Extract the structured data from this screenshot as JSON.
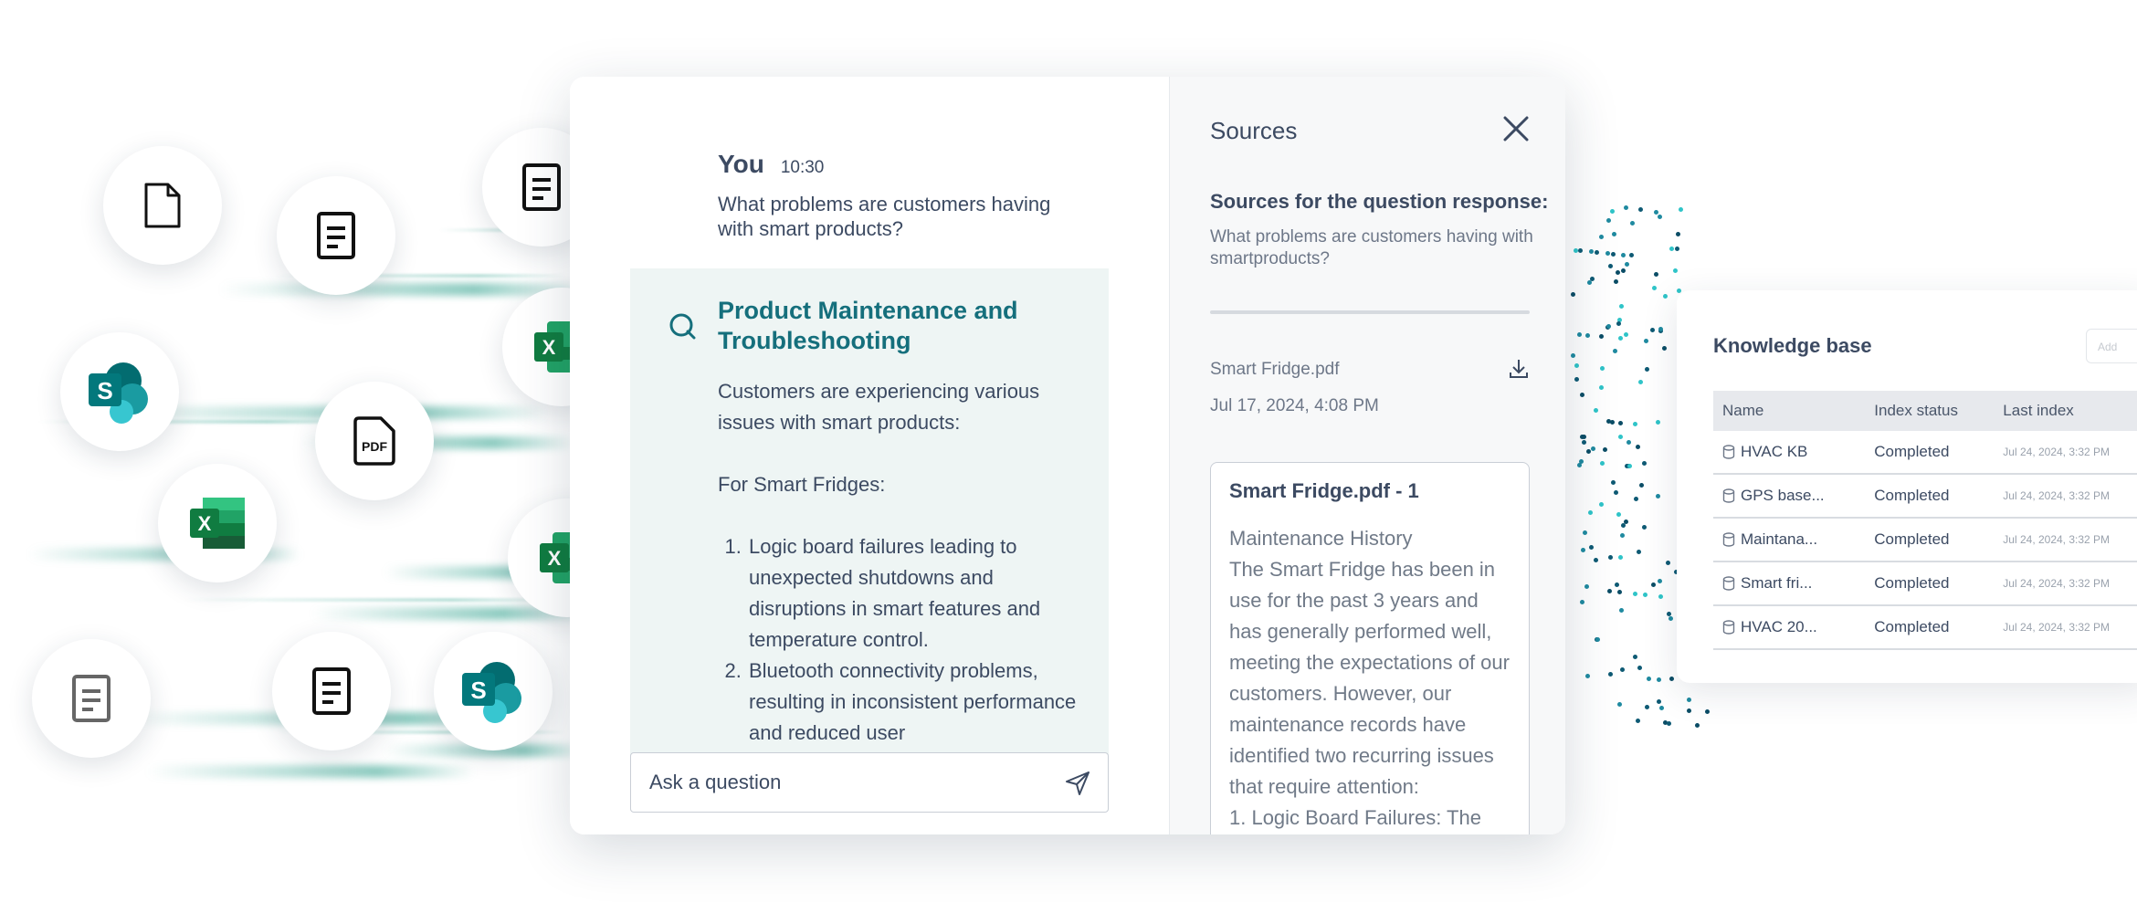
{
  "chat": {
    "user_name": "You",
    "time": "10:30",
    "question": "What problems are customers having with smart products?",
    "answer_title": "Product Maintenance and Troubleshooting",
    "answer_intro": "Customers are experiencing various issues with smart products:",
    "answer_section": "For Smart Fridges:",
    "answer_items": [
      "Logic board failures leading to unexpected shutdowns and disruptions in smart features and temperature control.",
      "Bluetooth connectivity problems, resulting in inconsistent performance and reduced user"
    ],
    "input_placeholder": "Ask a question"
  },
  "sources": {
    "title": "Sources",
    "subtitle": "Sources for the question response:",
    "question": "What problems are customers having with smartproducts?",
    "file_name": "Smart Fridge.pdf",
    "file_date": "Jul 17, 2024, 4:08 PM",
    "chunk_title": "Smart Fridge.pdf - 1",
    "chunk_text": "Maintenance History\nThe Smart Fridge has been in use for the past 3 years and has generally performed well, meeting the expectations of our customers. However, our maintenance records have identified two recurring issues that require attention:\n1. Logic Board Failures: The"
  },
  "knowledge_base": {
    "title": "Knowledge base",
    "add_button": "Add",
    "columns": [
      "Name",
      "Index status",
      "Last index"
    ],
    "rows": [
      {
        "name": "HVAC KB",
        "status": "Completed",
        "date": "Jul 24, 2024, 3:32 PM"
      },
      {
        "name": "GPS base...",
        "status": "Completed",
        "date": "Jul 24, 2024, 3:32 PM"
      },
      {
        "name": "Maintana...",
        "status": "Completed",
        "date": "Jul 24, 2024, 3:32 PM"
      },
      {
        "name": "Smart fri...",
        "status": "Completed",
        "date": "Jul 24, 2024, 3:32 PM"
      },
      {
        "name": "HVAC 20...",
        "status": "Completed",
        "date": "Jul 24, 2024, 3:32 PM"
      }
    ]
  },
  "icons": {
    "bubbles": [
      "file-icon",
      "document-icon",
      "document-icon",
      "sharepoint-icon",
      "pdf-icon",
      "excel-icon",
      "excel-icon",
      "excel-icon",
      "document-icon",
      "document-icon",
      "sharepoint-icon"
    ]
  },
  "colors": {
    "accent": "#156f7c",
    "answer_bg": "#eef5f4",
    "text": "#3c4a62",
    "muted": "#6d7788",
    "excel_green": "#107c41",
    "sharepoint_teal": "#038387"
  }
}
